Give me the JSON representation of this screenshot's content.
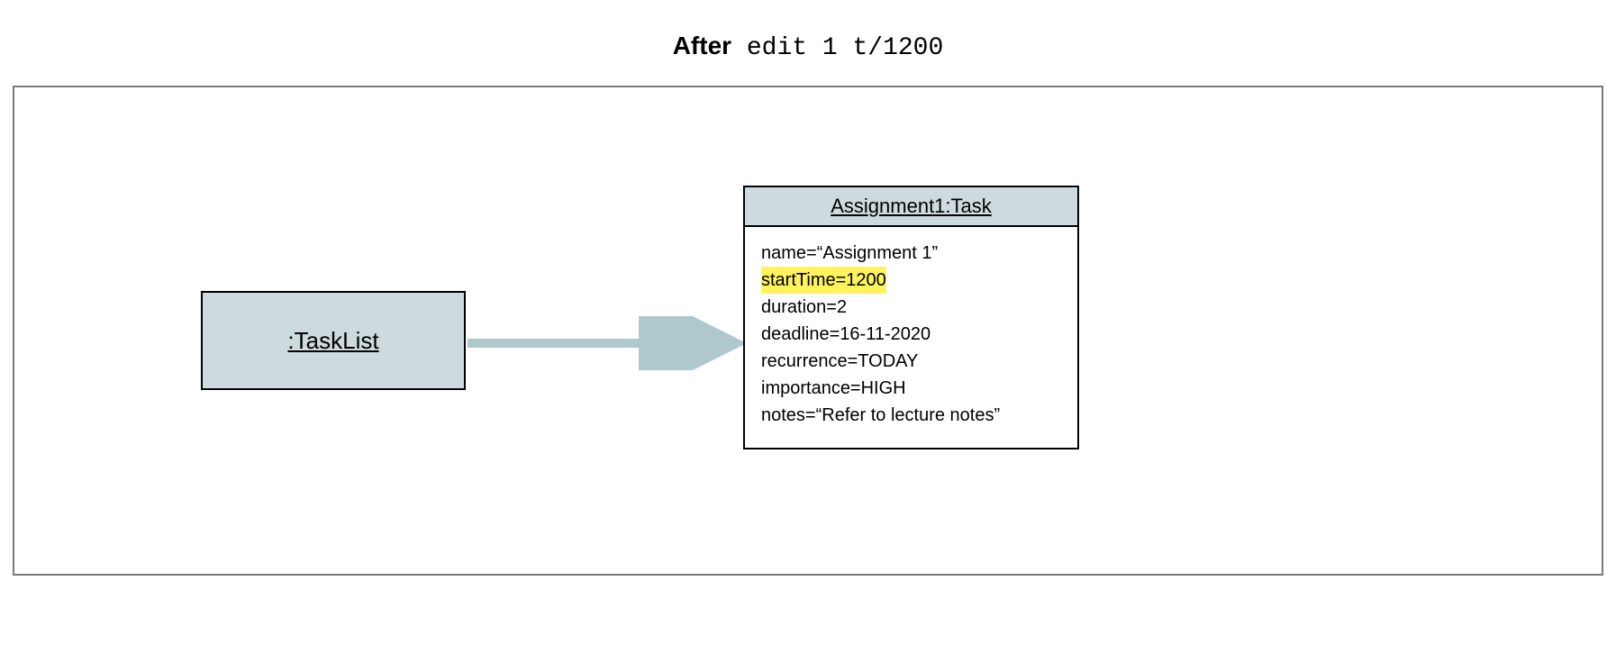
{
  "title": {
    "bold": "After",
    "mono": " edit 1 t/1200"
  },
  "tasklist": {
    "label": ":TaskList"
  },
  "task": {
    "header": "Assignment1:Task",
    "attrs": {
      "name": "name=“Assignment 1”",
      "startTime": "startTime=1200",
      "duration": "duration=2",
      "deadline": "deadline=16-11-2020",
      "recurrence": "recurrence=TODAY",
      "importance": "importance=HIGH",
      "notes": "notes=“Refer to lecture notes”"
    },
    "highlighted": "startTime"
  },
  "colors": {
    "boxFill": "#cddbde",
    "highlight": "#fff35c",
    "arrow": "#afc8cc"
  }
}
